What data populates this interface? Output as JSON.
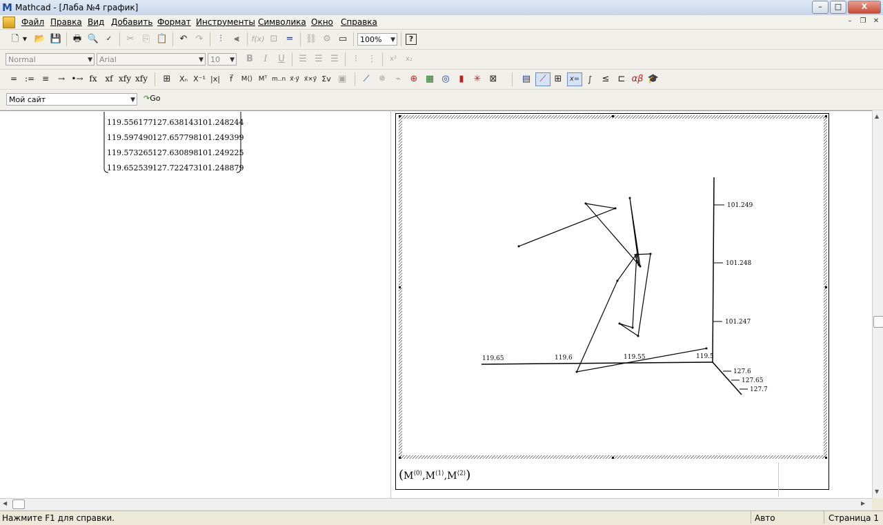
{
  "window": {
    "app_icon_letter": "M",
    "title": "Mathcad - [Лаба №4 график]",
    "minimize": "–",
    "maximize": "□",
    "close": "X"
  },
  "menu": {
    "items": [
      "Файл",
      "Правка",
      "Вид",
      "Добавить",
      "Формат",
      "Инструменты",
      "Символика",
      "Окно",
      "Справка"
    ]
  },
  "standard_toolbar": {
    "zoom": "100%",
    "help_button": "?"
  },
  "format_toolbar": {
    "style": "Normal",
    "font": "Arial",
    "size": "10",
    "bold": "B",
    "italic": "I",
    "underline": "U"
  },
  "math_toolbar": {
    "items": [
      "=",
      ":=",
      "≡",
      "→",
      "•→",
      "fx",
      "xf",
      "xfy",
      "xfy"
    ]
  },
  "resources_toolbar": {
    "location": "Мой сайт",
    "go_label": "Go"
  },
  "matrix": {
    "rows": [
      [
        "119.556177",
        "127.638143",
        "101.248244"
      ],
      [
        "119.597490",
        "127.657798",
        "101.249399"
      ],
      [
        "119.573265",
        "127.630898",
        "101.249225"
      ],
      [
        "119.652539",
        "127.722473",
        "101.248879"
      ]
    ]
  },
  "graph": {
    "formula_base": "M",
    "formula_indices": [
      "⟨0⟩",
      "⟨1⟩",
      "⟨2⟩"
    ],
    "x_axis_ticks": [
      "119.65",
      "119.6",
      "119.55",
      "119.5"
    ],
    "z_axis_ticks": [
      "101.249",
      "101.248",
      "101.247"
    ],
    "y_axis_ticks": [
      "127.6",
      "127.65",
      "127.7"
    ]
  },
  "status": {
    "help": "Нажмите F1 для справки.",
    "mode": "Авто",
    "page": "Страница 1"
  }
}
